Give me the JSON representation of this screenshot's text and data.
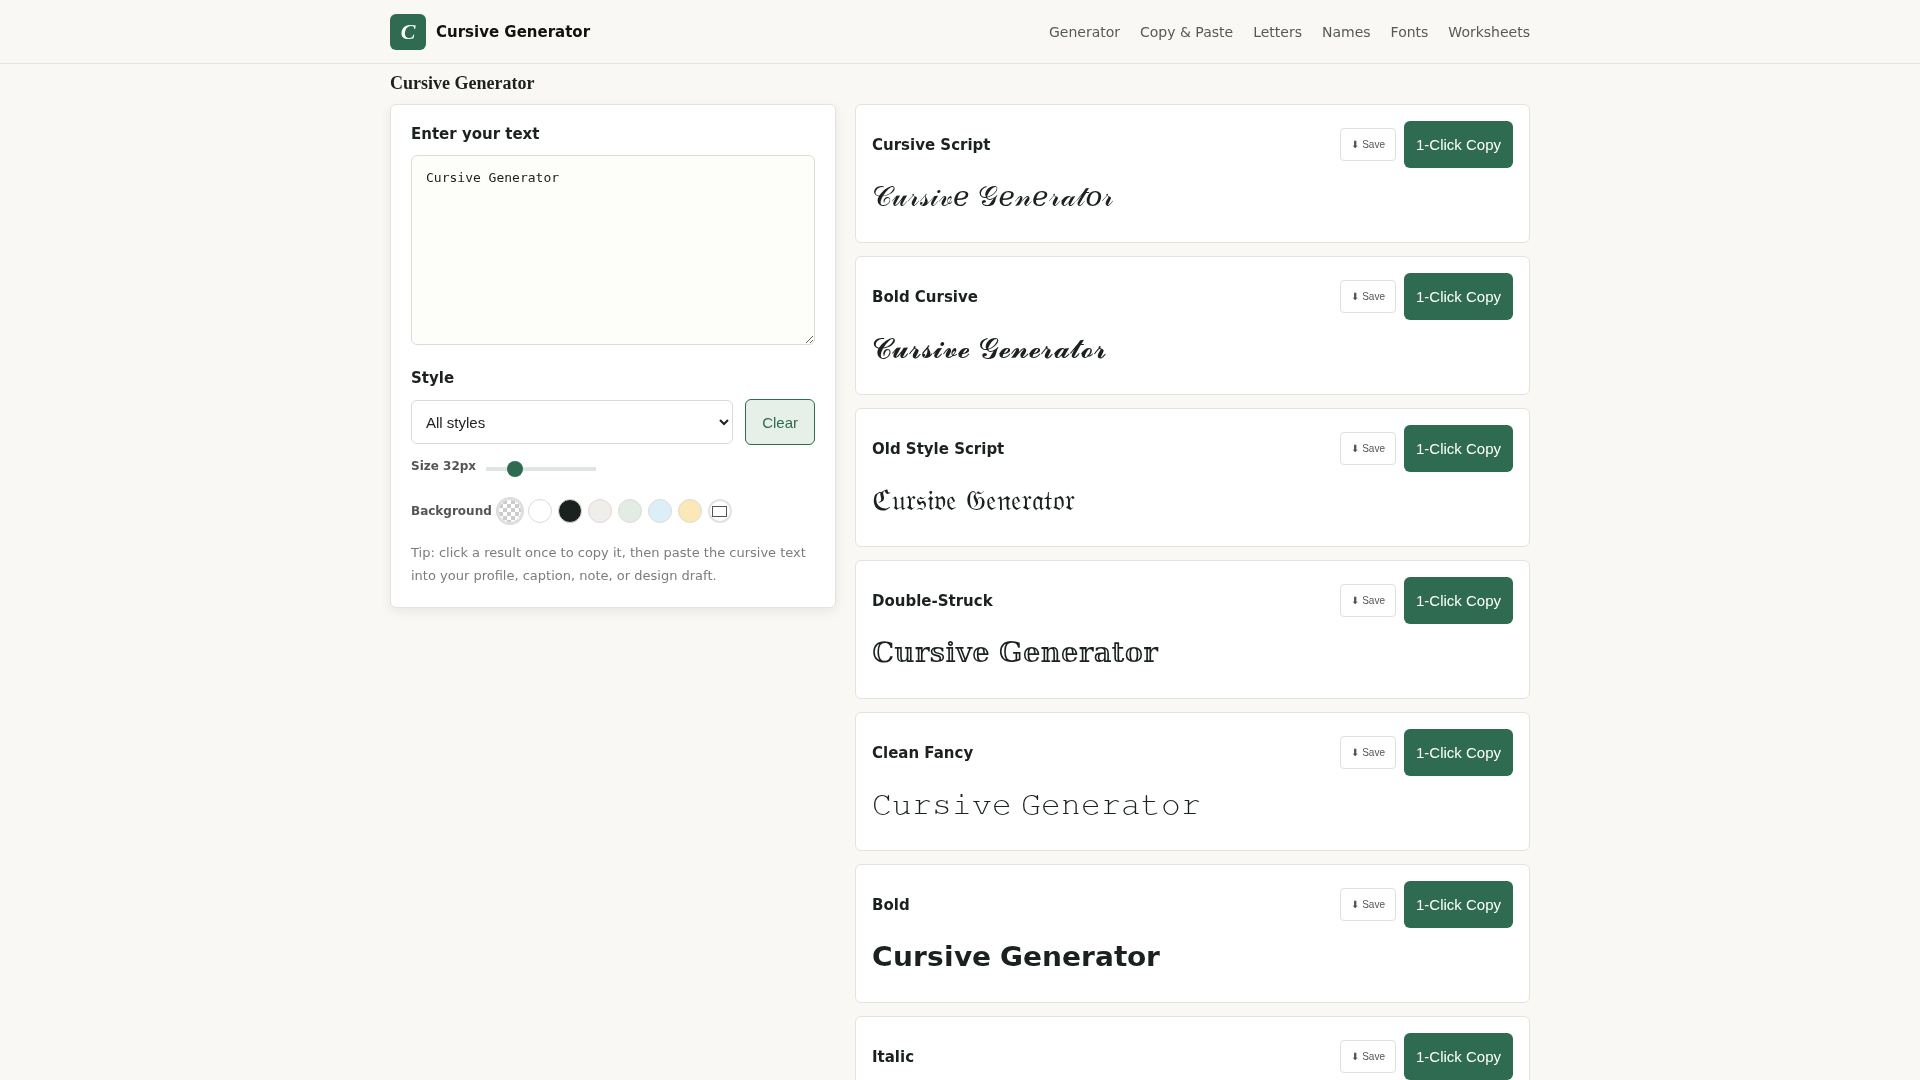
{
  "header": {
    "logo_letter": "C",
    "brand": "Cursive Generator",
    "nav": [
      {
        "label": "Generator"
      },
      {
        "label": "Copy & Paste"
      },
      {
        "label": "Letters"
      },
      {
        "label": "Names"
      },
      {
        "label": "Fonts"
      },
      {
        "label": "Worksheets"
      }
    ]
  },
  "page_title": "Cursive Generator",
  "editor": {
    "text_label": "Enter your text",
    "text_value": "Cursive Generator",
    "style_label": "Style",
    "style_value": "All styles",
    "clear_button": "Clear",
    "size_label": "Size 32px",
    "size": {
      "level": 0.26
    },
    "background_label": "Background",
    "swatches": [
      {
        "kind": "transparent",
        "selected": true
      },
      {
        "kind": "solid",
        "color": "#ffffff",
        "selected": false
      },
      {
        "kind": "solid",
        "color": "#1b211e",
        "selected": false
      },
      {
        "kind": "solid",
        "color": "#efeeeb",
        "selected": false
      },
      {
        "kind": "solid",
        "color": "#e2ebe4",
        "selected": false
      },
      {
        "kind": "solid",
        "color": "#dceff8",
        "selected": false
      },
      {
        "kind": "solid",
        "color": "#fbe7b7",
        "selected": false
      },
      {
        "kind": "frame",
        "selected": false
      }
    ],
    "tip": "Tip: click a result once to copy it, then paste the cursive text into your profile, caption, note, or design draft."
  },
  "results": [
    {
      "name": "Cursive Script",
      "output": "𝒞𝓊𝓇𝓈𝒾𝓋𝑒 𝒢𝑒𝓃𝑒𝓇𝒶𝓉𝑜𝓇",
      "save": "⬇ Save",
      "copy": "1-Click Copy"
    },
    {
      "name": "Bold Cursive",
      "output": "𝓒𝓾𝓻𝓼𝓲𝓿𝓮 𝓖𝓮𝓷𝓮𝓻𝓪𝓽𝓸𝓻",
      "save": "⬇ Save",
      "copy": "1-Click Copy"
    },
    {
      "name": "Old Style Script",
      "output": "ℭ𝔲𝔯𝔰𝔦𝔳𝔢 𝔊𝔢𝔫𝔢𝔯𝔞𝔱𝔬𝔯",
      "save": "⬇ Save",
      "copy": "1-Click Copy"
    },
    {
      "name": "Double-Struck",
      "output": "ℂ𝕦𝕣𝕤𝕚𝕧𝕖 𝔾𝕖𝕟𝕖𝕣𝕒𝕥𝕠𝕣",
      "save": "⬇ Save",
      "copy": "1-Click Copy"
    },
    {
      "name": "Clean Fancy",
      "output": "𝙲𝚞𝚛𝚜𝚒𝚟𝚎 𝙶𝚎𝚗𝚎𝚛𝚊𝚝𝚘𝚛",
      "save": "⬇ Save",
      "copy": "1-Click Copy"
    },
    {
      "name": "Bold",
      "output": "𝗖𝘂𝗿𝘀𝗶𝘃𝗲 𝗚𝗲𝗻𝗲𝗿𝗮𝘁𝗼𝗿",
      "save": "⬇ Save",
      "copy": "1-Click Copy"
    },
    {
      "name": "Italic",
      "save": "⬇ Save",
      "copy": "1-Click Copy"
    }
  ]
}
